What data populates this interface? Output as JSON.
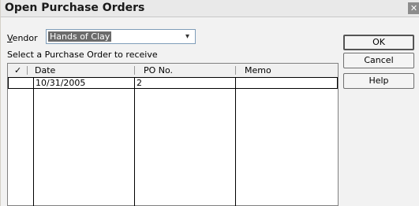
{
  "window": {
    "title": "Open Purchase Orders",
    "close_glyph": "✕"
  },
  "vendor": {
    "label_accel": "V",
    "label_rest": "endor",
    "value": "Hands of Clay",
    "dropdown_glyph": "▾"
  },
  "instruction": "Select a Purchase Order to receive",
  "table": {
    "columns": {
      "check": "✓",
      "date": "Date",
      "po_no": "PO No.",
      "memo": "Memo"
    },
    "rows": [
      {
        "check": "",
        "date": "10/31/2005",
        "po_no": "2",
        "memo": ""
      }
    ]
  },
  "buttons": {
    "ok": "OK",
    "cancel": "Cancel",
    "help": "Help"
  }
}
